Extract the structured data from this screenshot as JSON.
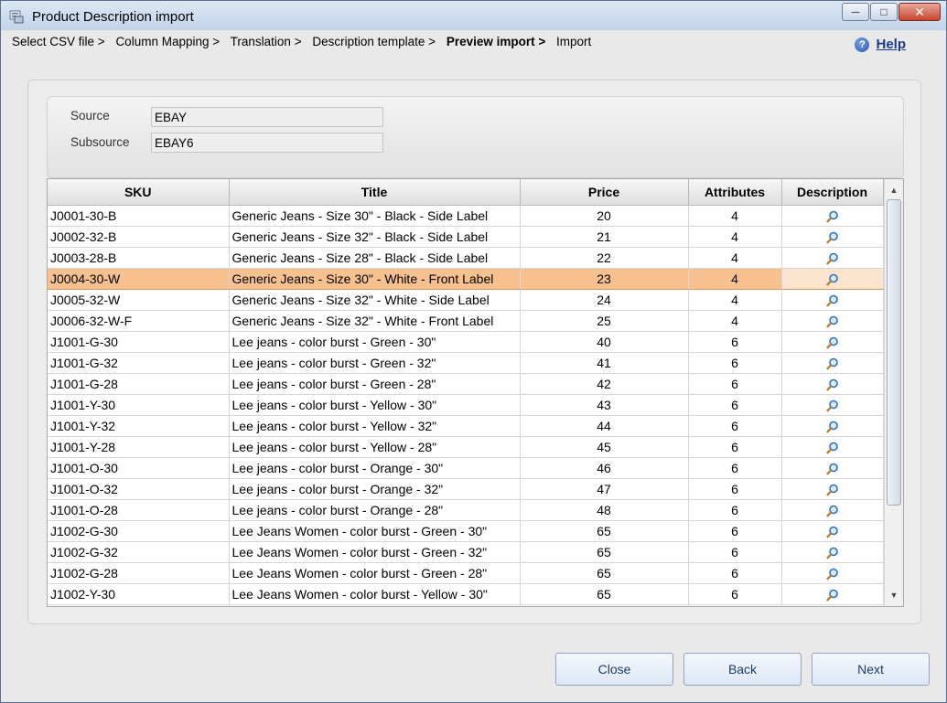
{
  "window": {
    "title": "Product Description import",
    "controls": {
      "minimize": "─",
      "maximize": "□",
      "close": "✕"
    }
  },
  "breadcrumb": [
    {
      "label": "Select CSV file >",
      "active": false
    },
    {
      "label": "Column Mapping >",
      "active": false
    },
    {
      "label": "Translation >",
      "active": false
    },
    {
      "label": "Description template >",
      "active": false
    },
    {
      "label": "Preview import >",
      "active": true
    },
    {
      "label": "Import",
      "active": false
    }
  ],
  "help": {
    "label": "Help",
    "icon": "question-icon"
  },
  "source": {
    "source_label": "Source",
    "source_value": "EBAY",
    "subsource_label": "Subsource",
    "subsource_value": "EBAY6"
  },
  "table": {
    "columns": [
      "SKU",
      "Title",
      "Price",
      "Attributes",
      "Description"
    ],
    "selected_index": 3,
    "rows": [
      {
        "sku": "J0001-30-B",
        "title": "Generic Jeans - Size 30\" - Black - Side Label",
        "price": "20",
        "attributes": "4"
      },
      {
        "sku": "J0002-32-B",
        "title": "Generic Jeans - Size 32\" - Black - Side Label",
        "price": "21",
        "attributes": "4"
      },
      {
        "sku": "J0003-28-B",
        "title": "Generic Jeans - Size 28\" - Black - Side Label",
        "price": "22",
        "attributes": "4"
      },
      {
        "sku": "J0004-30-W",
        "title": "Generic Jeans - Size 30\" - White - Front Label",
        "price": "23",
        "attributes": "4"
      },
      {
        "sku": "J0005-32-W",
        "title": "Generic Jeans - Size 32\" - White - Side Label",
        "price": "24",
        "attributes": "4"
      },
      {
        "sku": "J0006-32-W-F",
        "title": "Generic Jeans - Size 32\" - White - Front Label",
        "price": "25",
        "attributes": "4"
      },
      {
        "sku": "J1001-G-30",
        "title": "Lee jeans - color burst - Green - 30\"",
        "price": "40",
        "attributes": "6"
      },
      {
        "sku": "J1001-G-32",
        "title": "Lee jeans - color burst - Green - 32\"",
        "price": "41",
        "attributes": "6"
      },
      {
        "sku": "J1001-G-28",
        "title": "Lee jeans - color burst - Green - 28\"",
        "price": "42",
        "attributes": "6"
      },
      {
        "sku": "J1001-Y-30",
        "title": "Lee jeans - color burst - Yellow - 30\"",
        "price": "43",
        "attributes": "6"
      },
      {
        "sku": "J1001-Y-32",
        "title": "Lee jeans - color burst - Yellow - 32\"",
        "price": "44",
        "attributes": "6"
      },
      {
        "sku": "J1001-Y-28",
        "title": "Lee jeans - color burst - Yellow - 28\"",
        "price": "45",
        "attributes": "6"
      },
      {
        "sku": "J1001-O-30",
        "title": "Lee jeans - color burst - Orange - 30\"",
        "price": "46",
        "attributes": "6"
      },
      {
        "sku": "J1001-O-32",
        "title": "Lee jeans - color burst - Orange - 32\"",
        "price": "47",
        "attributes": "6"
      },
      {
        "sku": "J1001-O-28",
        "title": "Lee jeans - color burst - Orange - 28\"",
        "price": "48",
        "attributes": "6"
      },
      {
        "sku": "J1002-G-30",
        "title": "Lee Jeans Women - color burst - Green - 30\"",
        "price": "65",
        "attributes": "6"
      },
      {
        "sku": "J1002-G-32",
        "title": "Lee Jeans Women - color burst - Green - 32\"",
        "price": "65",
        "attributes": "6"
      },
      {
        "sku": "J1002-G-28",
        "title": "Lee Jeans Women - color burst - Green - 28\"",
        "price": "65",
        "attributes": "6"
      },
      {
        "sku": "J1002-Y-30",
        "title": "Lee Jeans Women - color burst - Yellow - 30\"",
        "price": "65",
        "attributes": "6"
      }
    ],
    "description_icon": "magnifier-icon"
  },
  "buttons": {
    "close": "Close",
    "back": "Back",
    "next": "Next"
  },
  "colors": {
    "selected_row": "#f6c08f",
    "selected_desc_cell": "#fbe3cd",
    "link": "#1a3a8f"
  }
}
